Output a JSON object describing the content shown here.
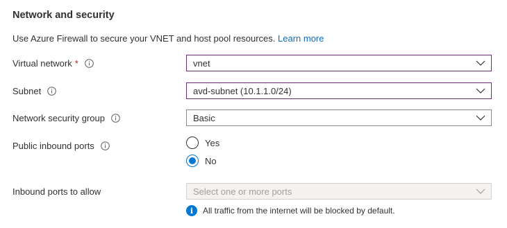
{
  "section": {
    "title": "Network and security",
    "description": "Use Azure Firewall to secure your VNET and host pool resources.",
    "learn_more": "Learn more"
  },
  "fields": {
    "virtual_network": {
      "label": "Virtual network",
      "required_mark": "*",
      "value": "vnet"
    },
    "subnet": {
      "label": "Subnet",
      "value": "avd-subnet (10.1.1.0/24)"
    },
    "nsg": {
      "label": "Network security group",
      "value": "Basic"
    },
    "public_inbound": {
      "label": "Public inbound ports",
      "options": [
        {
          "label": "Yes",
          "checked": false
        },
        {
          "label": "No",
          "checked": true
        }
      ]
    },
    "inbound_ports": {
      "label": "Inbound ports to allow",
      "placeholder": "Select one or more ports",
      "disabled": true
    }
  },
  "note": {
    "icon": "info-icon",
    "text": "All traffic from the internet will be blocked by default."
  },
  "colors": {
    "accent": "#0078d4",
    "link": "#0f6cbd",
    "required": "#a4262c",
    "focus_border": "#6b2a7b"
  }
}
